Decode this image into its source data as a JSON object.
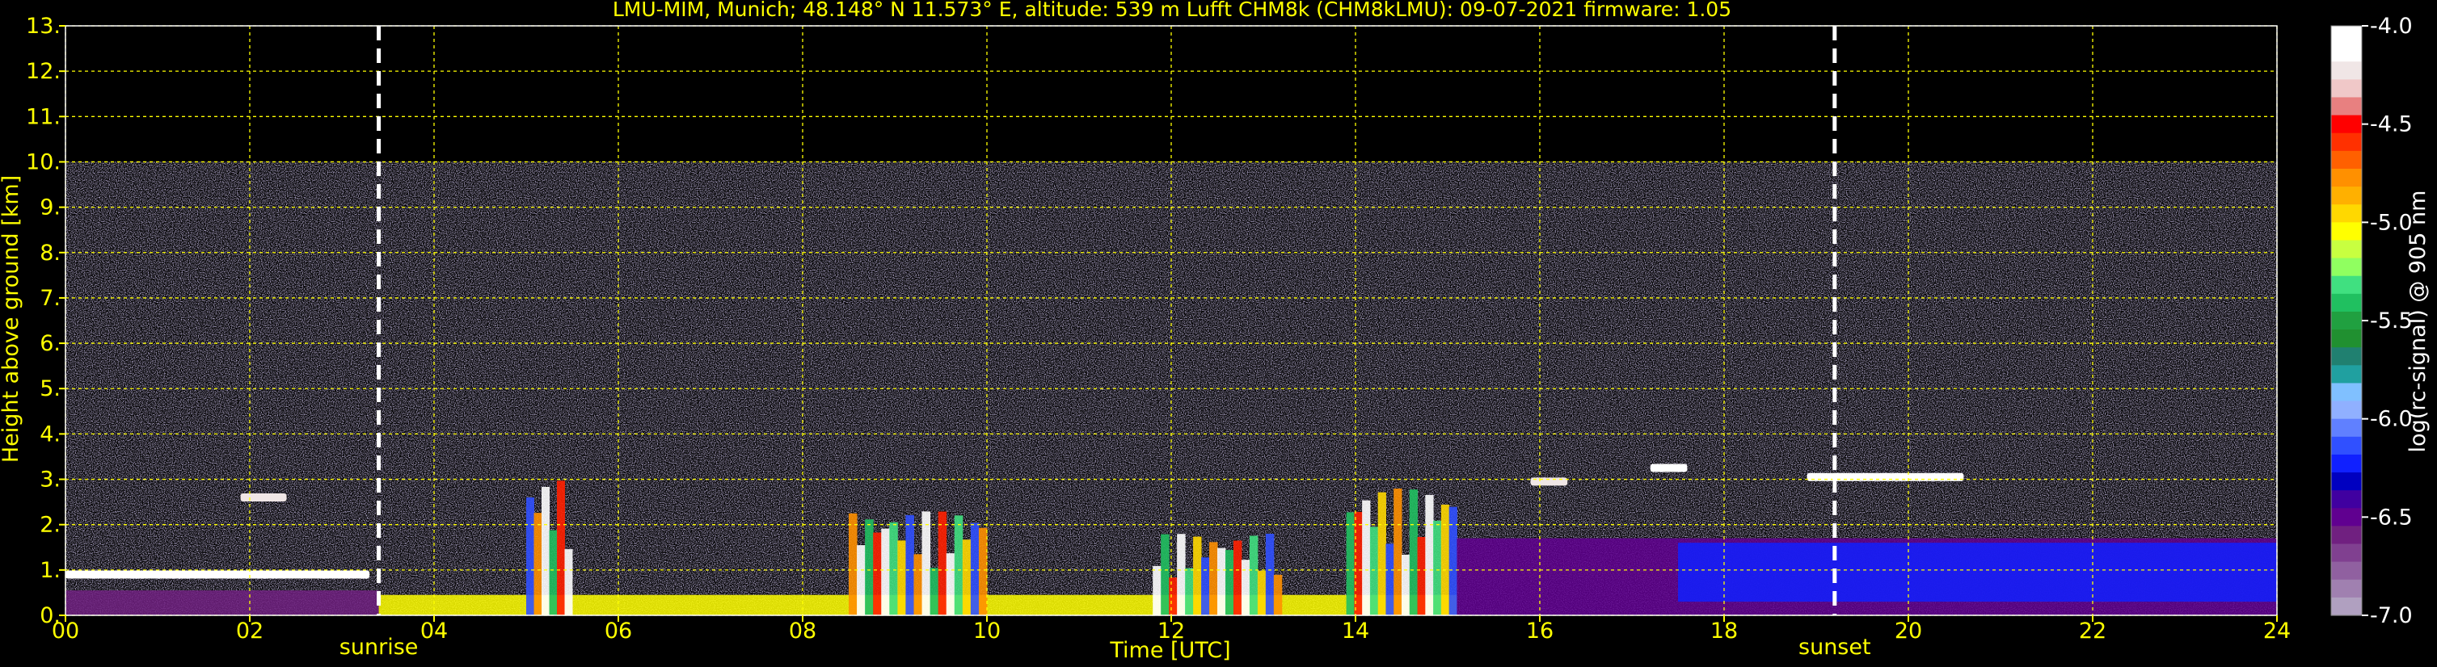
{
  "chart_data": {
    "type": "heatmap",
    "title": "LMU-MIM, Munich; 48.148° N 11.573° E, altitude: 539 m    Lufft CHM8k (CHM8kLMU): 09-07-2021    firmware: 1.05",
    "xlabel": "Time [UTC]",
    "ylabel": "Height above ground [km]",
    "xlim": [
      0,
      24
    ],
    "ylim": [
      0,
      13
    ],
    "x_ticks": [
      0,
      2,
      4,
      6,
      8,
      10,
      12,
      14,
      16,
      18,
      20,
      22,
      24
    ],
    "x_tick_labels": [
      "00",
      "02",
      "04",
      "06",
      "08",
      "10",
      "12",
      "14",
      "16",
      "18",
      "20",
      "22",
      "24"
    ],
    "y_ticks": [
      0,
      1,
      2,
      3,
      4,
      5,
      6,
      7,
      8,
      9,
      10,
      11,
      12,
      13
    ],
    "y_tick_labels": [
      "0.",
      "1.",
      "2.",
      "3.",
      "4.",
      "5.",
      "6.",
      "7.",
      "8.",
      "9.",
      "10.",
      "11.",
      "12.",
      "13."
    ],
    "grid": true,
    "grid_color": "#ffff00",
    "data_top_km": 10,
    "background_color": "#000000",
    "noise_color": "#8878b8",
    "markers": [
      {
        "label": "sunrise",
        "time": 3.4
      },
      {
        "label": "sunset",
        "time": 19.2
      }
    ],
    "colorbar": {
      "label": "log(rc-signal) @ 905 nm",
      "range": [
        -7.0,
        -4.0
      ],
      "ticks": [
        -4.0,
        -4.5,
        -5.0,
        -5.5,
        -6.0,
        -6.5,
        -7.0
      ],
      "tick_labels": [
        "-4.0",
        "-4.5",
        "-5.0",
        "-5.5",
        "-6.0",
        "-6.5",
        "-7.0"
      ],
      "colors": [
        "#ffffff",
        "#ffffff",
        "#f0e6e6",
        "#f0c8c8",
        "#e88080",
        "#ff0000",
        "#ff3000",
        "#ff6000",
        "#ff9000",
        "#ffb000",
        "#ffd800",
        "#ffff00",
        "#c8ff40",
        "#90ff60",
        "#40e080",
        "#20c060",
        "#20a040",
        "#209030",
        "#208070",
        "#20a0a0",
        "#80c0ff",
        "#90b0ff",
        "#6080ff",
        "#3050ff",
        "#1020ff",
        "#0000c0",
        "#4000a0",
        "#600090",
        "#702080",
        "#804090",
        "#9060a0",
        "#a080b0",
        "#b0a0c0"
      ]
    },
    "features": [
      {
        "kind": "surface_layer",
        "t0": 0.0,
        "t1": 3.4,
        "h0": 0.0,
        "h1": 0.55,
        "value": -6.6
      },
      {
        "kind": "boundary_layer_top",
        "t0": 0.0,
        "t1": 3.3,
        "h": 0.9,
        "value": -4.1
      },
      {
        "kind": "cloud",
        "t0": 1.9,
        "t1": 2.4,
        "h": 2.6,
        "value": -4.2
      },
      {
        "kind": "surface_layer",
        "t0": 3.4,
        "t1": 15.1,
        "h0": 0.0,
        "h1": 0.45,
        "value": -5.0
      },
      {
        "kind": "convective_plume",
        "t0": 5.0,
        "t1": 5.5,
        "h0": 0.0,
        "h1": 3.0,
        "value": -4.6
      },
      {
        "kind": "convective_plume",
        "t0": 8.5,
        "t1": 10.0,
        "h0": 0.0,
        "h1": 2.3,
        "value": -4.8
      },
      {
        "kind": "convective_plume",
        "t0": 11.8,
        "t1": 13.2,
        "h0": 0.0,
        "h1": 1.8,
        "value": -5.8
      },
      {
        "kind": "convective_plume",
        "t0": 13.9,
        "t1": 15.1,
        "h0": 0.0,
        "h1": 2.8,
        "value": -4.3
      },
      {
        "kind": "aerosol_layer",
        "t0": 15.1,
        "t1": 24.0,
        "h0": 0.0,
        "h1": 1.7,
        "value": -6.5
      },
      {
        "kind": "blue_aerosol_band",
        "t0": 17.5,
        "t1": 24.0,
        "h0": 0.3,
        "h1": 1.6,
        "value": -6.2
      },
      {
        "kind": "cloud",
        "t0": 18.9,
        "t1": 20.6,
        "h": 3.05,
        "value": -4.1
      },
      {
        "kind": "cloud",
        "t0": 17.2,
        "t1": 17.6,
        "h": 3.25,
        "value": -4.1
      },
      {
        "kind": "cloud",
        "t0": 15.9,
        "t1": 16.3,
        "h": 2.95,
        "value": -4.2
      }
    ]
  }
}
